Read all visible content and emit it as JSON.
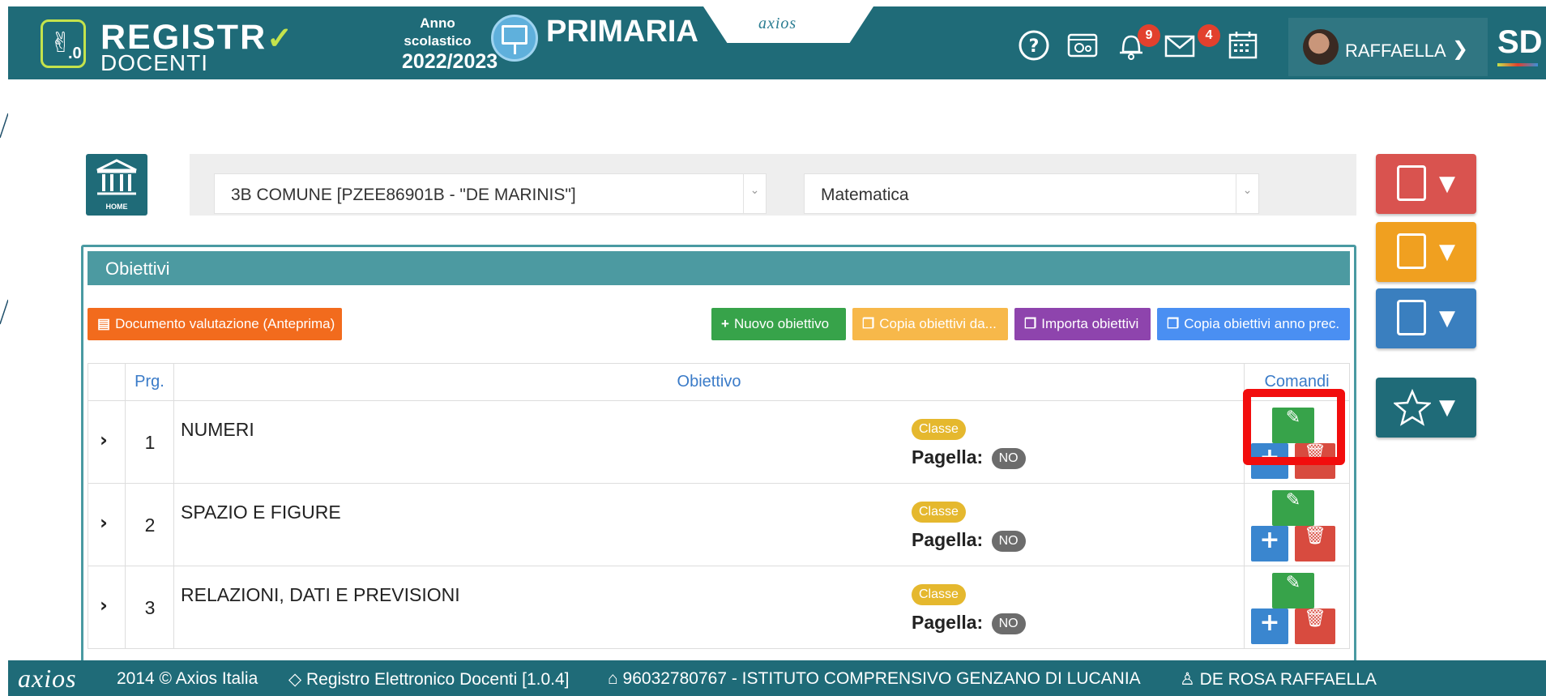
{
  "header": {
    "brand_line1": "REGISTR",
    "brand_line2": "DOCENTI",
    "logo_mark": ".0",
    "anno_label": "Anno scolastico",
    "anno_value": "2022/2023",
    "school_level": "PRIMARIA",
    "axios_logo": "axios",
    "notifications_count": "9",
    "messages_count": "4",
    "user_name": "RAFFAELLA",
    "app_badge": "SD",
    "icons": [
      "help-icon",
      "settings-icon",
      "bell-icon",
      "mail-icon",
      "calendar-icon"
    ]
  },
  "home": {
    "label": "HOME"
  },
  "selects": {
    "class_value": "3B COMUNE [PZEE86901B - \"DE MARINIS\"]",
    "subject_value": "Matematica"
  },
  "panel": {
    "title": "Obiettivi",
    "buttons": {
      "documento": "Documento valutazione (Anteprima)",
      "nuovo": "Nuovo obiettivo",
      "copia_da": "Copia obiettivi da...",
      "importa": "Importa obiettivi",
      "copia_anno": "Copia obiettivi anno prec."
    }
  },
  "table": {
    "headers": [
      "",
      "Prg.",
      "Obiettivo",
      "Comandi"
    ],
    "rows": [
      {
        "prg": "1",
        "obiettivo": "NUMERI",
        "tag": "Classe",
        "pagella_label": "Pagella:",
        "pagella_value": "NO"
      },
      {
        "prg": "2",
        "obiettivo": "SPAZIO E FIGURE",
        "tag": "Classe",
        "pagella_label": "Pagella:",
        "pagella_value": "NO"
      },
      {
        "prg": "3",
        "obiettivo": "RELAZIONI, DATI E PREVISIONI",
        "tag": "Classe",
        "pagella_label": "Pagella:",
        "pagella_value": "NO"
      }
    ]
  },
  "side_buttons": [
    {
      "name": "checklist",
      "color": "#d9534f"
    },
    {
      "name": "graduation",
      "color": "#f0a020"
    },
    {
      "name": "report",
      "color": "#3a7fbf"
    },
    {
      "name": "favorites",
      "color": "#1f6b78"
    }
  ],
  "footer": {
    "logo": "axios",
    "copyright": "2014 © Axios Italia",
    "app": "Registro Elettronico Docenti [1.0.4]",
    "school": "96032780767 - ISTITUTO COMPRENSIVO GENZANO DI LUCANIA",
    "user": "DE ROSA RAFFAELLA"
  },
  "colors": {
    "primary": "#1f6b78",
    "panel_header": "#4c9aa1",
    "btn_orange": "#f26b1d",
    "btn_green": "#37a34a",
    "btn_amber": "#f7b84a",
    "btn_purple": "#8e44ad",
    "btn_blue": "#4a8ff2",
    "highlight": "#f20d0d"
  }
}
